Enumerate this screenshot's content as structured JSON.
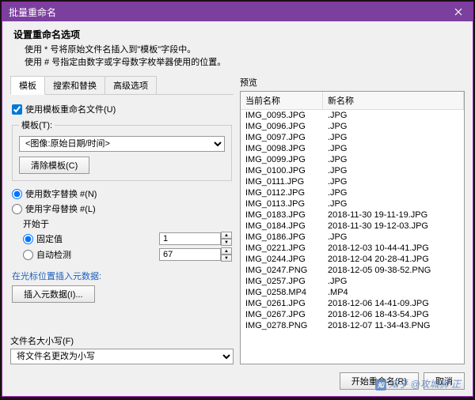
{
  "title": "批量重命名",
  "header": {
    "h1": "设置重命名选项",
    "h2a": "使用 * 号将原始文件名插入到\"模板\"字段中。",
    "h2b": "使用 # 号指定由数字或字母数字枚举器使用的位置。"
  },
  "tabs": {
    "template": "模板",
    "search": "搜索和替换",
    "advanced": "高级选项"
  },
  "left": {
    "useTemplateChk": "使用模板重命名文件(U)",
    "templateLabel": "模板(T):",
    "templateSelect": "<图像:原始日期/时间>",
    "clearBtn": "清除模板(C)",
    "numReplace": "使用数字替换 #(N)",
    "alphaReplace": "使用字母替换 #(L)",
    "startAt": "开始于",
    "fixed": "固定值",
    "auto": "自动检测",
    "fixedVal": "1",
    "autoVal": "67",
    "insertMetaLabel": "在光标位置插入元数据:",
    "insertMetaBtn": "插入元数据(I)...",
    "fileCaseLabel": "文件名大小写(F)",
    "fileCaseSelect": "将文件名更改为小写"
  },
  "preview": {
    "label": "预览",
    "col1": "当前名称",
    "col2": "新名称",
    "rows": [
      {
        "a": "IMG_0095.JPG",
        "b": ".JPG"
      },
      {
        "a": "IMG_0096.JPG",
        "b": ".JPG"
      },
      {
        "a": "IMG_0097.JPG",
        "b": ".JPG"
      },
      {
        "a": "IMG_0098.JPG",
        "b": ".JPG"
      },
      {
        "a": "IMG_0099.JPG",
        "b": ".JPG"
      },
      {
        "a": "IMG_0100.JPG",
        "b": ".JPG"
      },
      {
        "a": "IMG_0111.JPG",
        "b": ".JPG"
      },
      {
        "a": "IMG_0112.JPG",
        "b": ".JPG"
      },
      {
        "a": "IMG_0113.JPG",
        "b": ".JPG"
      },
      {
        "a": "IMG_0183.JPG",
        "b": "2018-11-30 19-11-19.JPG"
      },
      {
        "a": "IMG_0184.JPG",
        "b": "2018-11-30 19-12-03.JPG"
      },
      {
        "a": "IMG_0186.JPG",
        "b": ".JPG"
      },
      {
        "a": "IMG_0221.JPG",
        "b": "2018-12-03 10-44-41.JPG"
      },
      {
        "a": "IMG_0244.JPG",
        "b": "2018-12-04 20-28-41.JPG"
      },
      {
        "a": "IMG_0247.PNG",
        "b": "2018-12-05 09-38-52.PNG"
      },
      {
        "a": "IMG_0257.JPG",
        "b": ".JPG"
      },
      {
        "a": "IMG_0258.MP4",
        "b": ".MP4"
      },
      {
        "a": "IMG_0261.JPG",
        "b": "2018-12-06 14-41-09.JPG"
      },
      {
        "a": "IMG_0267.JPG",
        "b": "2018-12-06 18-43-54.JPG"
      },
      {
        "a": "IMG_0278.PNG",
        "b": "2018-12-07 11-34-43.PNG"
      }
    ]
  },
  "footer": {
    "start": "开始重命名(R)",
    "cancel": "取消"
  },
  "watermark": "知乎 @攻城狮 正"
}
